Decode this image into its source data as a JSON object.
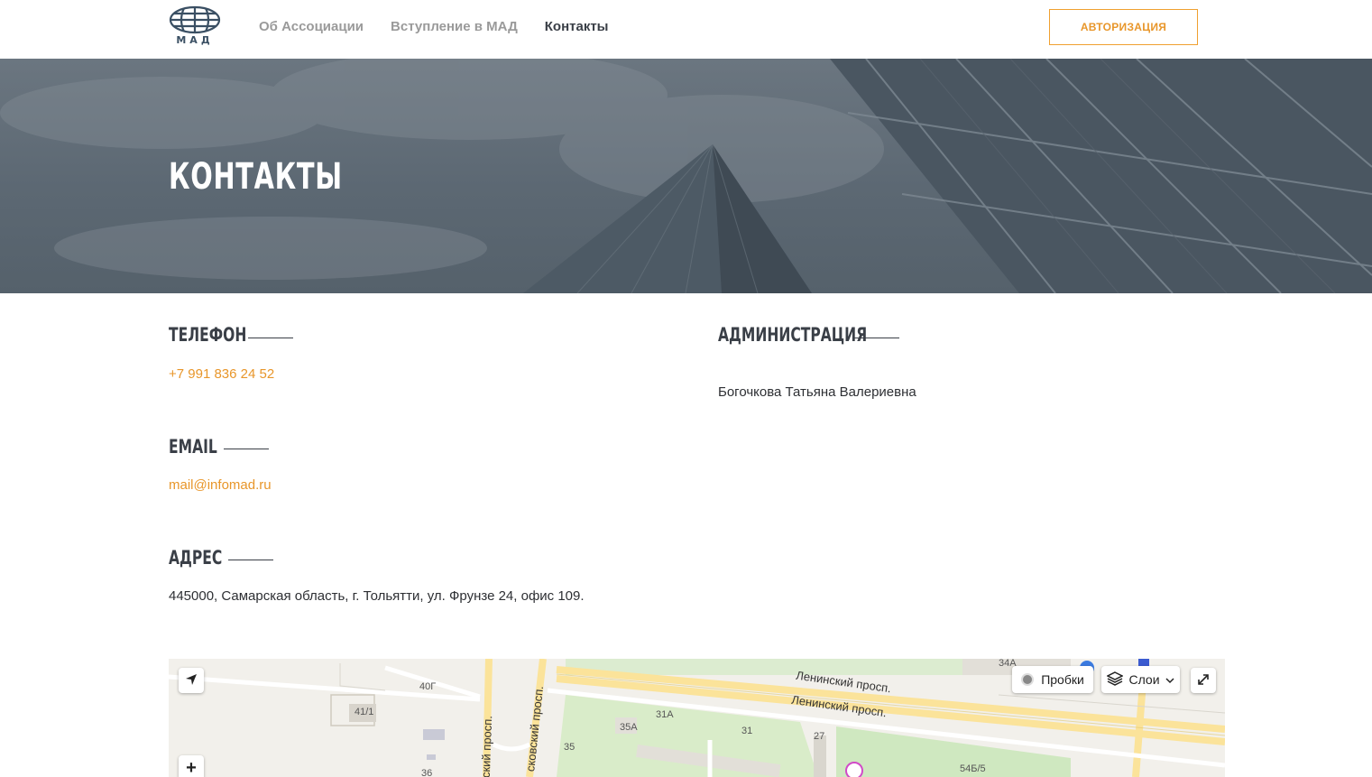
{
  "header": {
    "logo_text": "МАД",
    "nav": [
      {
        "label": "Об Ассоциации",
        "active": false
      },
      {
        "label": "Вступление в МАД",
        "active": false
      },
      {
        "label": "Контакты",
        "active": true
      }
    ],
    "auth_label": "АВТОРИЗАЦИЯ"
  },
  "hero": {
    "title": "КОНТАКТЫ"
  },
  "contacts": {
    "phone": {
      "title": "ТЕЛЕФОН",
      "value": "+7 991 836 24 52"
    },
    "email": {
      "title": "EMAIL",
      "value": "mail@infomad.ru"
    },
    "address": {
      "title": "АДРЕС",
      "value": "445000, Самарская область, г. Тольятти, ул. Фрунзе 24, офис 109."
    },
    "admin": {
      "title": "АДМИНИСТРАЦИЯ",
      "value": "Богочкова Татьяна Валериевна"
    }
  },
  "map": {
    "traffic_label": "Пробки",
    "layers_label": "Слои",
    "streets": [
      "Ленинский просп.",
      "Ленинский просп.",
      "ский просп.",
      "сковский просп."
    ],
    "buildings": [
      "40Г",
      "41/1",
      "35А",
      "31А",
      "31",
      "35",
      "36",
      "27",
      "54Б/5",
      "34А"
    ]
  },
  "colors": {
    "accent": "#e8962a",
    "dark": "#3a3f47",
    "nav_muted": "#9a9a9a"
  }
}
